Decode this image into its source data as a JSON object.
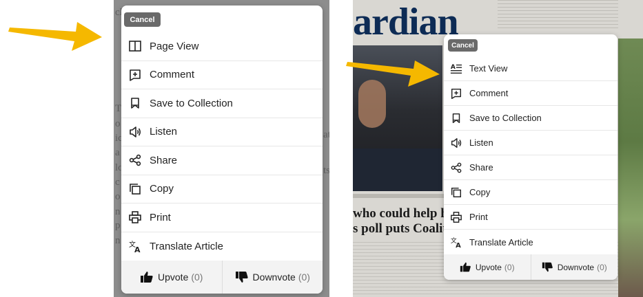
{
  "left_panel": {
    "cancel_label": "Cancel",
    "items": [
      {
        "label": "Page View",
        "icon": "page-view-icon"
      },
      {
        "label": "Comment",
        "icon": "comment-icon"
      },
      {
        "label": "Save to Collection",
        "icon": "bookmark-icon"
      },
      {
        "label": "Listen",
        "icon": "speaker-icon"
      },
      {
        "label": "Share",
        "icon": "share-icon"
      },
      {
        "label": "Copy",
        "icon": "copy-icon"
      },
      {
        "label": "Print",
        "icon": "print-icon"
      },
      {
        "label": "Translate Article",
        "icon": "translate-icon"
      }
    ],
    "upvote_label": "Upvote",
    "upvote_count": "(0)",
    "downvote_label": "Downvote",
    "downvote_count": "(0)"
  },
  "right_panel": {
    "cancel_label": "Cancel",
    "items": [
      {
        "label": "Text View",
        "icon": "text-view-icon"
      },
      {
        "label": "Comment",
        "icon": "comment-icon"
      },
      {
        "label": "Save to Collection",
        "icon": "bookmark-icon"
      },
      {
        "label": "Listen",
        "icon": "speaker-icon"
      },
      {
        "label": "Share",
        "icon": "share-icon"
      },
      {
        "label": "Copy",
        "icon": "copy-icon"
      },
      {
        "label": "Print",
        "icon": "print-icon"
      },
      {
        "label": "Translate Article",
        "icon": "translate-icon"
      }
    ],
    "upvote_label": "Upvote",
    "upvote_count": "(0)",
    "downvote_label": "Downvote",
    "downvote_count": "(0)"
  },
  "background": {
    "masthead": "ardian",
    "headline_line1": "who could help him",
    "headline_line2": "s poll puts Coalition"
  },
  "colors": {
    "arrow": "#f5b800",
    "cancel_bg": "#6a6a6a",
    "dim_overlay": "#8d8d8d",
    "masthead": "#0d2b55"
  }
}
